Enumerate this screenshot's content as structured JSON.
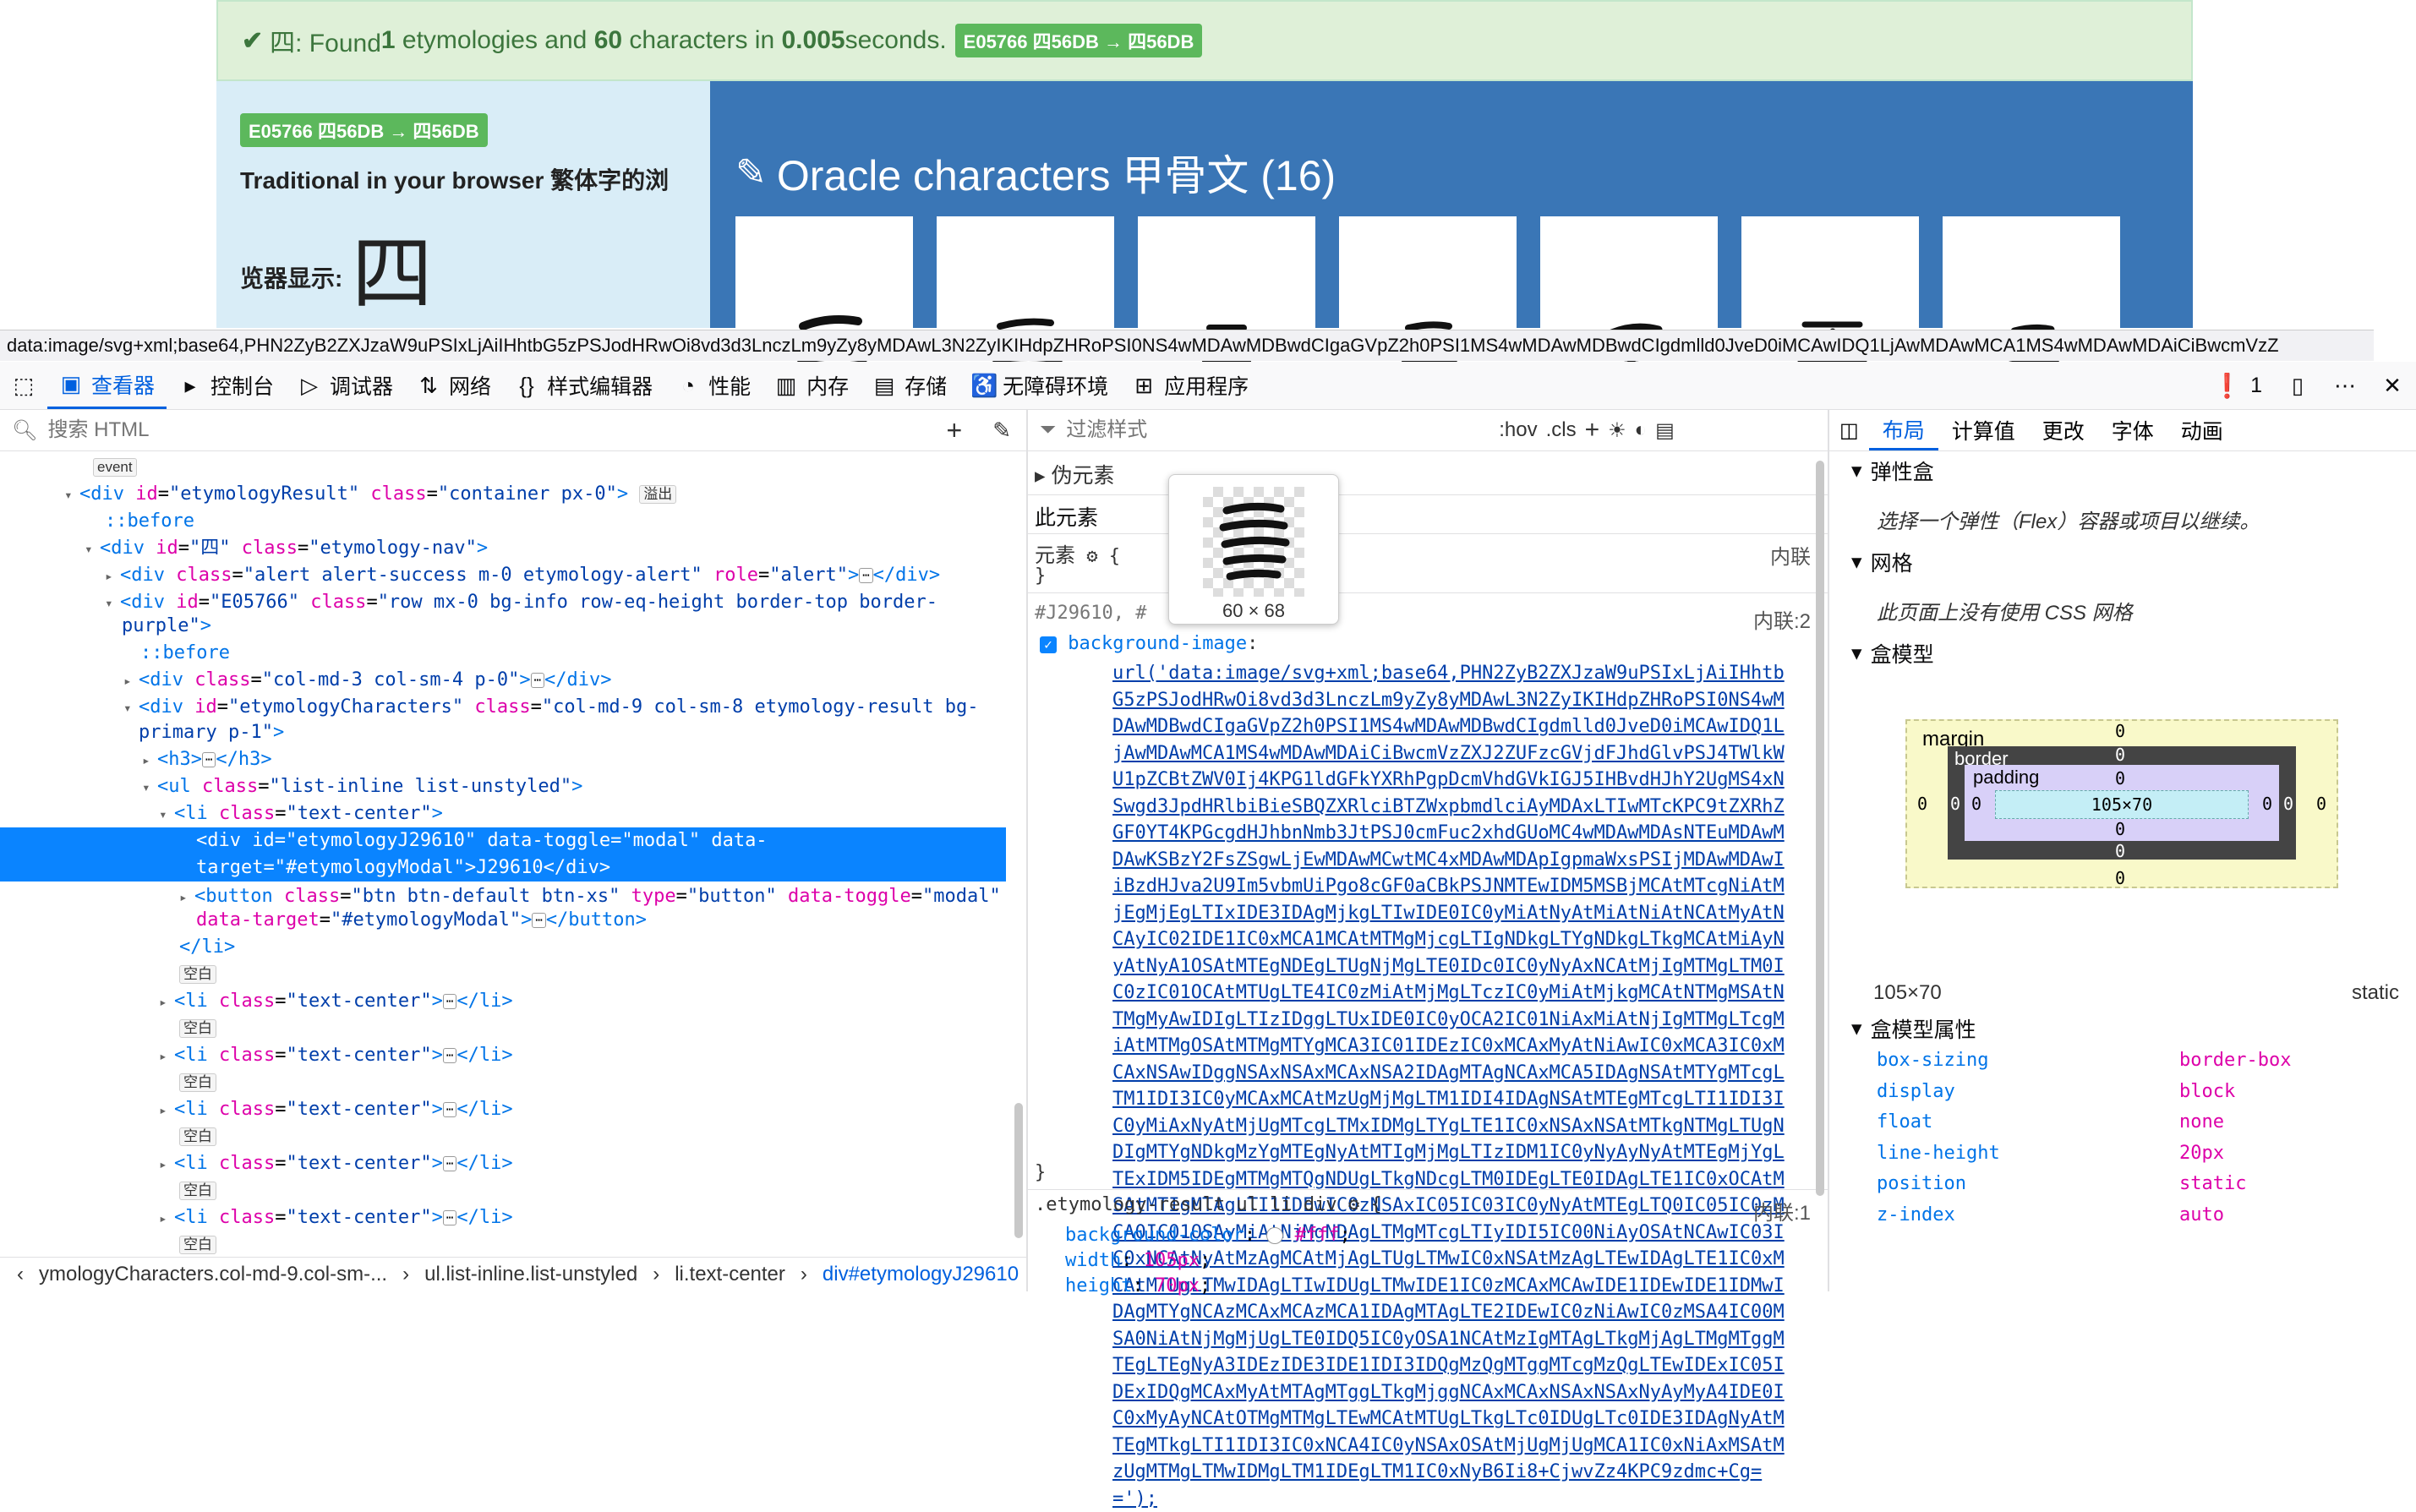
{
  "webpage": {
    "alert": {
      "check": "✔",
      "text_pre": "四: Found ",
      "count1": "1",
      "text_mid": " etymologies and ",
      "count2": "60",
      "text_mid2": " characters in ",
      "time": "0.005",
      "text_post": " seconds.",
      "pill": "E05766 四56DB → 四56DB"
    },
    "left": {
      "pill": "E05766 四56DB → 四56DB",
      "heading": "Traditional in your browser 繁体字的浏",
      "heading2": "览器显示:",
      "char": "四"
    },
    "right": {
      "edit_icon": "edit-icon",
      "title": "Oracle characters 甲骨文 (16)"
    }
  },
  "url_tooltip": "data:image/svg+xml;base64,PHN2ZyB2ZXJzaW9uPSIxLjAiIHhtbG5zPSJodHRwOi8vd3d3LnczLm9yZy8yMDAwL3N2ZyIKIHdpZHRoPSI0NS4wMDAwMDBwdCIgaGVpZ2h0PSI1MS4wMDAwMDBwdCIgdmlld0JveD0iMCAwIDQ1LjAwMDAwMCA1MS4wMDAwMDAiCiBwcmVzZ",
  "toolbar": {
    "tabs": [
      {
        "icon": "inspector-icon",
        "label": "查看器",
        "active": true
      },
      {
        "icon": "console-icon",
        "label": "控制台"
      },
      {
        "icon": "debugger-icon",
        "label": "调试器"
      },
      {
        "icon": "network-icon",
        "label": "网络"
      },
      {
        "icon": "style-editor-icon",
        "label": "样式编辑器"
      },
      {
        "icon": "performance-icon",
        "label": "性能"
      },
      {
        "icon": "memory-icon",
        "label": "内存"
      },
      {
        "icon": "storage-icon",
        "label": "存储"
      },
      {
        "icon": "accessibility-icon",
        "label": "无障碍环境"
      },
      {
        "icon": "application-icon",
        "label": "应用程序"
      }
    ],
    "error_count": "1"
  },
  "html_panel": {
    "search_placeholder": "搜索 HTML",
    "event_badge": "event",
    "overflow_badge": "溢出",
    "blank_badge": "空白",
    "breadcrumbs": [
      "ymologyCharacters.col-md-9.col-sm-...",
      "ul.list-inline.list-unstyled",
      "li.text-center",
      "div#etymologyJ29610"
    ]
  },
  "rules_panel": {
    "filter_placeholder": "过滤样式",
    "hov": ":hov",
    "cls": ".cls",
    "pseudo_elements": "伪元素",
    "this_element": "此元素",
    "element_label": "元素",
    "inline": "内联",
    "selector1": "#J29610, #",
    "inline2": "内联:2",
    "prop1": "background-image",
    "url_value": "url('data:image/svg+xml;base64,PHN2ZyB2ZXJzaW9uPSIxLjAiIHhtbG5zPSJodHRwOi8vd3d3LnczLm9yZy8yMDAwL3N2ZyIKIHdpZHRoPSI0NS4wMDAwMDBwdCIgaGVpZ2h0PSI1MS4wMDAwMDBwdCIgdmlld0JveD0iMCAwIDQ1LjAwMDAwMCA1MS4wMDAwMDAiCiBwcmVzZXJ2ZUFzcGVjdFJhdGlvPSJ4TWlkWU1pZCBtZWV0Ij4KPG1ldGFkYXRhPgpDcmVhdGVkIGJ5IHBvdHJhY2UgMS4xNSwgd3JpdHRlbiBieSBQZXRlciBTZWxpbmdlciAyMDAxLTIwMTcKPC9tZXRhZGF0YT4KPGcgdHJhbnNmb3JtPSJ0cmFuc2xhdGUoMC4wMDAwMDAsNTEuMDAwMDAwKSBzY2FsZSgwLjEwMDAwMCwtMC4xMDAwMDApIgpmaWxsPSIjMDAwMDAwIiBzdHJva2U9Im5vbmUiPgo8cGF0aCBkPSJNMTEwIDM5MSBjMCAtMTcgNiAtMjEgMjEgLTIxIDE3IDAgMjkgLTIwIDE0IC0yMiAtNyAtMiAtNiAtNCAtMyAtNCAyIC02IDE1IC0xMCA1MCAtMTMgMjcgLTIgNDkgLTYgNDkgLTkgMCAtMiAyNyAtNyA1OSAtMTEgNDEgLTUgNjMgLTE0IDc0IC0yNyAxNCAtMjIgMTMgLTM0IC0zIC01OCAtMTUgLTE4IC0zMiAtMjMgLTczIC0yMiAtMjkgMCAtNTMgMSAtNTMgMyAwIDIgLTIzIDggLTUxIDE0IC0yOCA2IC01NiAxMiAtNjIgMTMgLTcgMiAtMTMgOSAtMTMgMTYgMCA3IC01IDEzIC0xMCAxMyAtNiAwIC0xMCA3IC0xMCAxNSAwIDggNSAxNSAxMCAxNSA2IDAgMTAgNCAxMCA5IDAgNSAtMTYgMTcgLTM1IDI3IC0yMCAxMCAtMzUgMjMgLTM1IDI4IDAgNSAtMTEgMTcgLTI1IDI3IC0yMiAxNyAtMjUgMTcgLTMxIDMgLTYgLTE1IC0xNSAxNSAtMTkgNTMgLTUgNDIgMTYgNDkgMzYgMTEgNyAtMTIgMjMgLTIzIDM1IC0yNyAyNyAtMTEgMjYgLTExIDM5IDEgMTMgMTQgNDUgLTkgNDcgLTM0IDEgLTE0IDAgLTE1IC0xOCAtMSAtMTIgMTAgLTI1IDEwIC0zNSAxIC05IC03IC0yNyAtMTEgLTQ0IC05IC0zMCA0IC01OSAyMiAtNjMgNDAgLTMgMTcgLTIyIDI5IC00NiAyOSAtNCAwIC03IC0xNCAtNyAtMzAgMCAtMjAgLTUgLTMwIC0xNSAtMzAgLTEwIDAgLTE1IC0xMCAtMTUgLTMwIDAgLTIwIDUgLTMwIDE1IC0zMCAxMCAwIDE1IDEwIDE1IDMwIDAgMTYgNCAzMCAxMCAzMCA1IDAgMTAgLTE2IDEwIC0zNiAwIC0zMSA4IC00MSA0NiAtNjMgMjUgLTE0IDQ5IC0yOSA1NCAtMzIgMTAgLTkgMjAgLTMgMTggMTEgLTEgNyA3IDEzIDE3IDE1IDI3IDQgMzQgMTggMTcgMzQgLTEwIDExIC05IDExIDQgMCAxMyAtMTAgMTggLTkgMjggNCAxMCAxNSAxNSAxNyAyMyA4IDE0IC0xMyAyNCAtOTMgMTMgLTEwMCAtMTUgLTkgLTc0IDUgLTc0IDE3IDAgNyAtMTEgMTkgLTI1IDI3IC0xNCA4IC0yNSAxOSAtMjUgMjUgMCA1IC0xNiAxMSAtMzUgMTMgLTMwIDMgLTM1IDEgLTM1IC0xNyB6Ii8+CjwvZz4KPC9zdmc+Cg==');",
    "rule2_selector": ".etymology-result ul li div",
    "rule2_inline": "内联:1",
    "rule2_props": [
      {
        "name": "background-color",
        "value": "#fff"
      },
      {
        "name": "width",
        "value": "105px"
      },
      {
        "name": "height",
        "value": "70px"
      }
    ],
    "tooltip_size": "60 × 68"
  },
  "layout_panel": {
    "tabs": [
      "布局",
      "计算值",
      "更改",
      "字体",
      "动画"
    ],
    "flexbox_title": "弹性盒",
    "flexbox_text": "选择一个弹性（Flex）容器或项目以继续。",
    "grid_title": "网格",
    "grid_text": "此页面上没有使用 CSS 网格",
    "boxmodel_title": "盒模型",
    "margin_label": "margin",
    "border_label": "border",
    "padding_label": "padding",
    "content_size": "105×70",
    "zero": "0",
    "size_text": "105×70",
    "position_text": "static",
    "props_title": "盒模型属性",
    "props": [
      {
        "name": "box-sizing",
        "value": "border-box"
      },
      {
        "name": "display",
        "value": "block"
      },
      {
        "name": "float",
        "value": "none"
      },
      {
        "name": "line-height",
        "value": "20px"
      },
      {
        "name": "position",
        "value": "static"
      },
      {
        "name": "z-index",
        "value": "auto"
      }
    ]
  }
}
